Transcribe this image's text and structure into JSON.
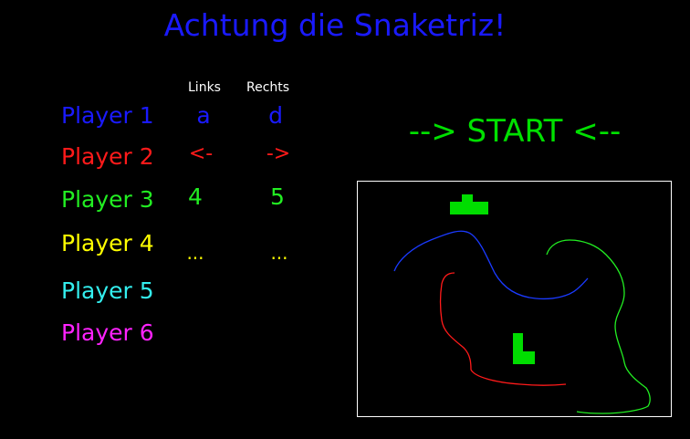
{
  "title": "Achtung die Snaketriz!",
  "colors": {
    "title": "#1a1aff",
    "start": "#00e000",
    "header": "#ffffff",
    "preview_border": "#ffffff"
  },
  "columns": {
    "left": "Links",
    "right": "Rechts"
  },
  "players": [
    {
      "label": "Player 1",
      "left_key": "a",
      "right_key": "d",
      "color": "#1a1aff"
    },
    {
      "label": "Player 2",
      "left_key": "<-",
      "right_key": "->",
      "color": "#ff1a1a"
    },
    {
      "label": "Player 3",
      "left_key": "4",
      "right_key": "5",
      "color": "#22ee22"
    },
    {
      "label": "Player 4",
      "left_key": "...",
      "right_key": "...",
      "color": "#ffff00"
    },
    {
      "label": "Player 5",
      "left_key": "",
      "right_key": "",
      "color": "#33eeee"
    },
    {
      "label": "Player 6",
      "left_key": "",
      "right_key": "",
      "color": "#ff22ff"
    }
  ],
  "start_button": "--> START <--",
  "preview": {
    "snake_colors": [
      "#1a3aff",
      "#ff1a1a",
      "#22ee22"
    ],
    "tetromino_color": "#00dd00"
  }
}
